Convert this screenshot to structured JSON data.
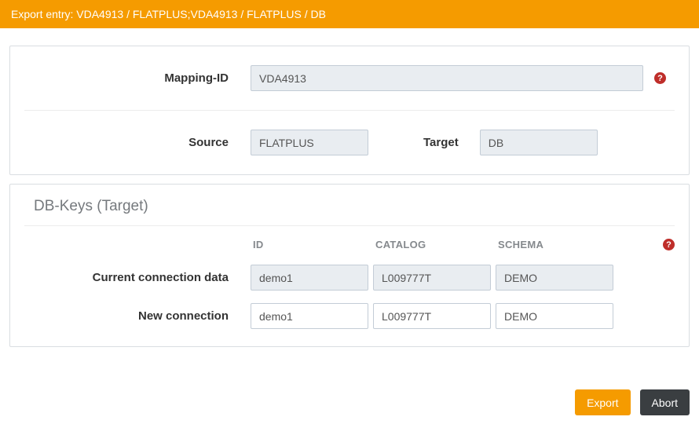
{
  "header": {
    "title": "Export entry: VDA4913 / FLATPLUS;VDA4913 / FLATPLUS / DB"
  },
  "mapping": {
    "mapping_id": {
      "label": "Mapping-ID",
      "value": "VDA4913"
    },
    "source": {
      "label": "Source",
      "value": "FLATPLUS"
    },
    "target": {
      "label": "Target",
      "value": "DB"
    }
  },
  "db_keys": {
    "title": "DB-Keys (Target)",
    "columns": [
      "ID",
      "CATALOG",
      "SCHEMA"
    ],
    "rows": [
      {
        "label": "Current connection data",
        "id": "demo1",
        "catalog": "L009777T",
        "schema": "DEMO"
      },
      {
        "label": "New connection",
        "id": "demo1",
        "catalog": "L009777T",
        "schema": "DEMO"
      }
    ]
  },
  "footer": {
    "export": "Export",
    "abort": "Abort"
  },
  "icons": {
    "help": "?"
  },
  "colors": {
    "accent_orange": "#f59b00",
    "abort_dark": "#3a3e41",
    "help_red": "#bf2e2a"
  }
}
